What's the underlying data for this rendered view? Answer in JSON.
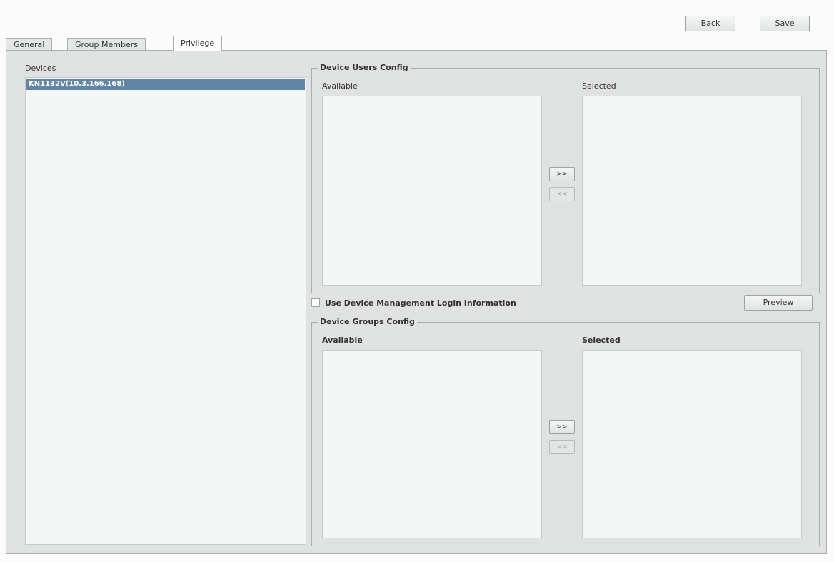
{
  "toolbar": {
    "back_label": "Back",
    "save_label": "Save"
  },
  "tabs": [
    {
      "label": "General"
    },
    {
      "label": "Group Members"
    },
    {
      "label": "Privilege"
    }
  ],
  "devices": {
    "label": "Devices",
    "items": [
      "KN1132V(10.3.166.168)"
    ]
  },
  "device_users_config": {
    "legend": "Device Users Config",
    "available_label": "Available",
    "selected_label": "Selected",
    "add_label": ">>",
    "remove_label": "<<"
  },
  "use_device_login": {
    "label": "Use Device Management Login Information",
    "checked": false
  },
  "preview_label": "Preview",
  "device_groups_config": {
    "legend": "Device Groups Config",
    "available_label": "Available",
    "selected_label": "Selected",
    "add_label": ">>",
    "remove_label": "<<"
  }
}
